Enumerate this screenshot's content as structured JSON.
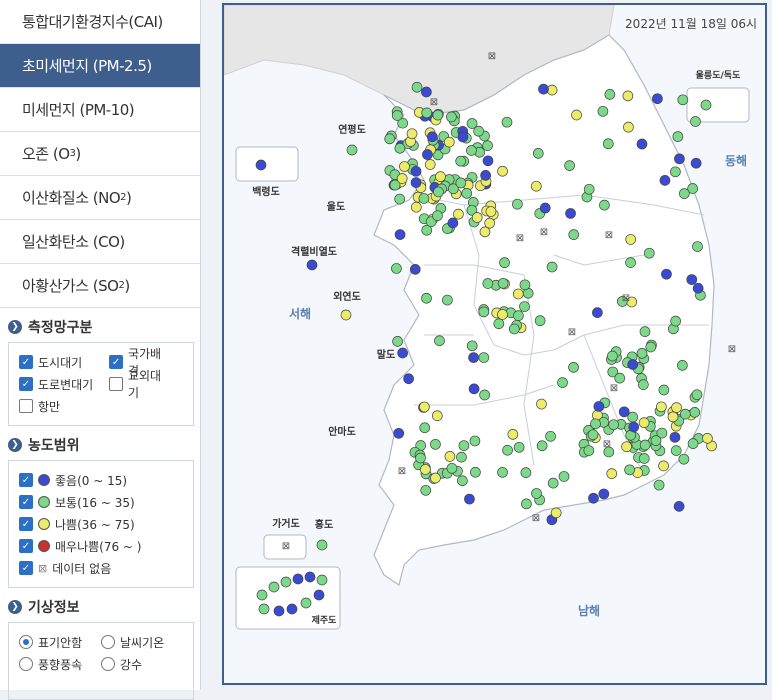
{
  "menu": [
    {
      "label": "통합대기환경지수(CAI)",
      "sub": "",
      "suffix": "",
      "active": false
    },
    {
      "label": "초미세먼지 (PM-2.5)",
      "sub": "",
      "suffix": "",
      "active": true
    },
    {
      "label": "미세먼지 (PM-10)",
      "sub": "",
      "suffix": "",
      "active": false
    },
    {
      "label": "오존 (O",
      "sub": "3",
      "suffix": ")",
      "active": false
    },
    {
      "label": "이산화질소 (NO",
      "sub": "2",
      "suffix": ")",
      "active": false
    },
    {
      "label": "일산화탄소 (CO)",
      "sub": "",
      "suffix": "",
      "active": false
    },
    {
      "label": "아황산가스 (SO",
      "sub": "2",
      "suffix": ")",
      "active": false
    }
  ],
  "network": {
    "title": "측정망구분",
    "items": [
      {
        "label": "도시대기",
        "checked": true
      },
      {
        "label": "국가배경",
        "checked": true
      },
      {
        "label": "도로변대기",
        "checked": true
      },
      {
        "label": "교외대기",
        "checked": false
      },
      {
        "label": "항만",
        "checked": false
      }
    ]
  },
  "concentration": {
    "title": "농도범위",
    "items": [
      {
        "label": "좋음(0 ~ 15)",
        "checked": true,
        "color": "#3b4bd1",
        "icon": "dot"
      },
      {
        "label": "보통(16 ~ 35)",
        "checked": true,
        "color": "#7cd98a",
        "icon": "dot"
      },
      {
        "label": "나쁨(36 ~ 75)",
        "checked": true,
        "color": "#ecec6a",
        "icon": "dot"
      },
      {
        "label": "매우나쁨(76 ~ )",
        "checked": true,
        "color": "#c9322c",
        "icon": "dot"
      },
      {
        "label": "데이터 없음",
        "checked": true,
        "color": "#888888",
        "icon": "x-mark"
      }
    ]
  },
  "weather": {
    "title": "기상정보",
    "options": [
      {
        "label": "표기안함",
        "selected": true
      },
      {
        "label": "날씨기온",
        "selected": false
      },
      {
        "label": "풍향풍속",
        "selected": false
      },
      {
        "label": "강수",
        "selected": false
      }
    ]
  },
  "map": {
    "timestamp": "2022년 11월 18일 06시",
    "labels": {
      "baengnyeong": "백령도",
      "yeonpyeong": "연평도",
      "ulleung": "울릉도/독도",
      "donghae": "동해",
      "seohae": "서해",
      "namhae": "남해",
      "uldo": "울도",
      "gyeokryeol": "격렬비열도",
      "oeyeon": "외연도",
      "maldo": "말도",
      "anmado": "안마도",
      "gageodo": "가거도",
      "hongdo": "홍도",
      "jeju": "제주도"
    }
  }
}
